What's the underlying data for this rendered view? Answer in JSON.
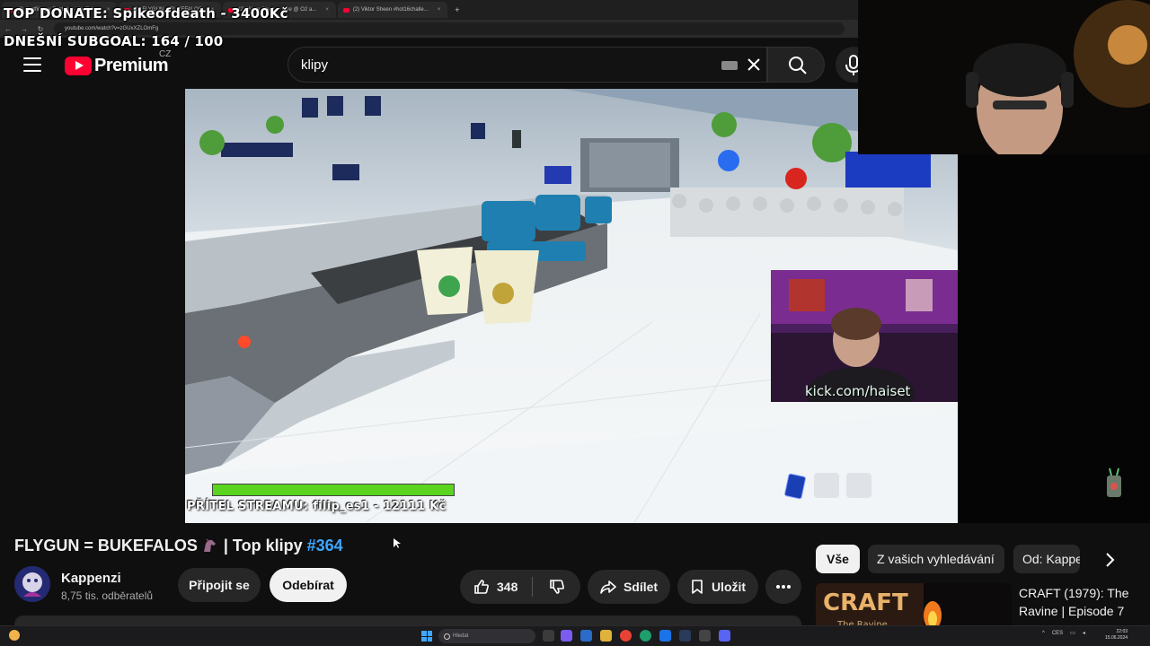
{
  "stream_overlay": {
    "top_donate": "TOP DONATE: Spikeofdeath - 3400Kč",
    "subgoal": "DNEŠNÍ SUBGOAL: 164 / 100"
  },
  "browser": {
    "tabs": [
      {
        "label": "(2) Justfiring v Roztoky - YouTube"
      },
      {
        "label": "(2) FLYGUN = BUKEFALOS"
      },
      {
        "label": "(2) Viktor Sheen - Live @ O2 a..."
      },
      {
        "label": "(2) Viktor Sheen #hot16challe..."
      }
    ],
    "new_tab": "+",
    "url": "youtube.com/watch?v=zGUxXZLOmFg"
  },
  "header": {
    "logo_text": "Premium",
    "region": "CZ",
    "search_value": "klipy"
  },
  "player": {
    "progress": 1.0,
    "friend_text": "PŘÍTEL STREAMU: filip_es1 - 12111 Kč",
    "kick_label": "kick.com/haiset"
  },
  "video": {
    "title_main": "FLYGUN = BUKEFALOS",
    "title_tail": " | Top klipy ",
    "title_hashtag": "#364"
  },
  "channel": {
    "name": "Kappenzi",
    "subscribers": "8,75 tis. odběratelů",
    "join_label": "Připojit se",
    "subscribe_label": "Odebírat"
  },
  "actions": {
    "like_count": "348",
    "share_label": "Sdílet",
    "save_label": "Uložit"
  },
  "chips": {
    "all": "Vše",
    "from_searches": "Z vašich vyhledávání",
    "from_channel": "Od: Kappenzi"
  },
  "suggestion": {
    "thumb_text": "CRAFT",
    "thumb_sub": "The Ravine",
    "title": "CRAFT (1979): The Ravine | Episode 7"
  },
  "taskbar": {
    "search_placeholder": "Hledat",
    "lang": "CES",
    "time": "22:03",
    "date": "15.06.2024"
  },
  "colors": {
    "yt_red": "#ff0033",
    "hashtag_blue": "#3ea6ff",
    "progress_green": "#5ad41e",
    "page_bg": "#0f0f0f"
  }
}
